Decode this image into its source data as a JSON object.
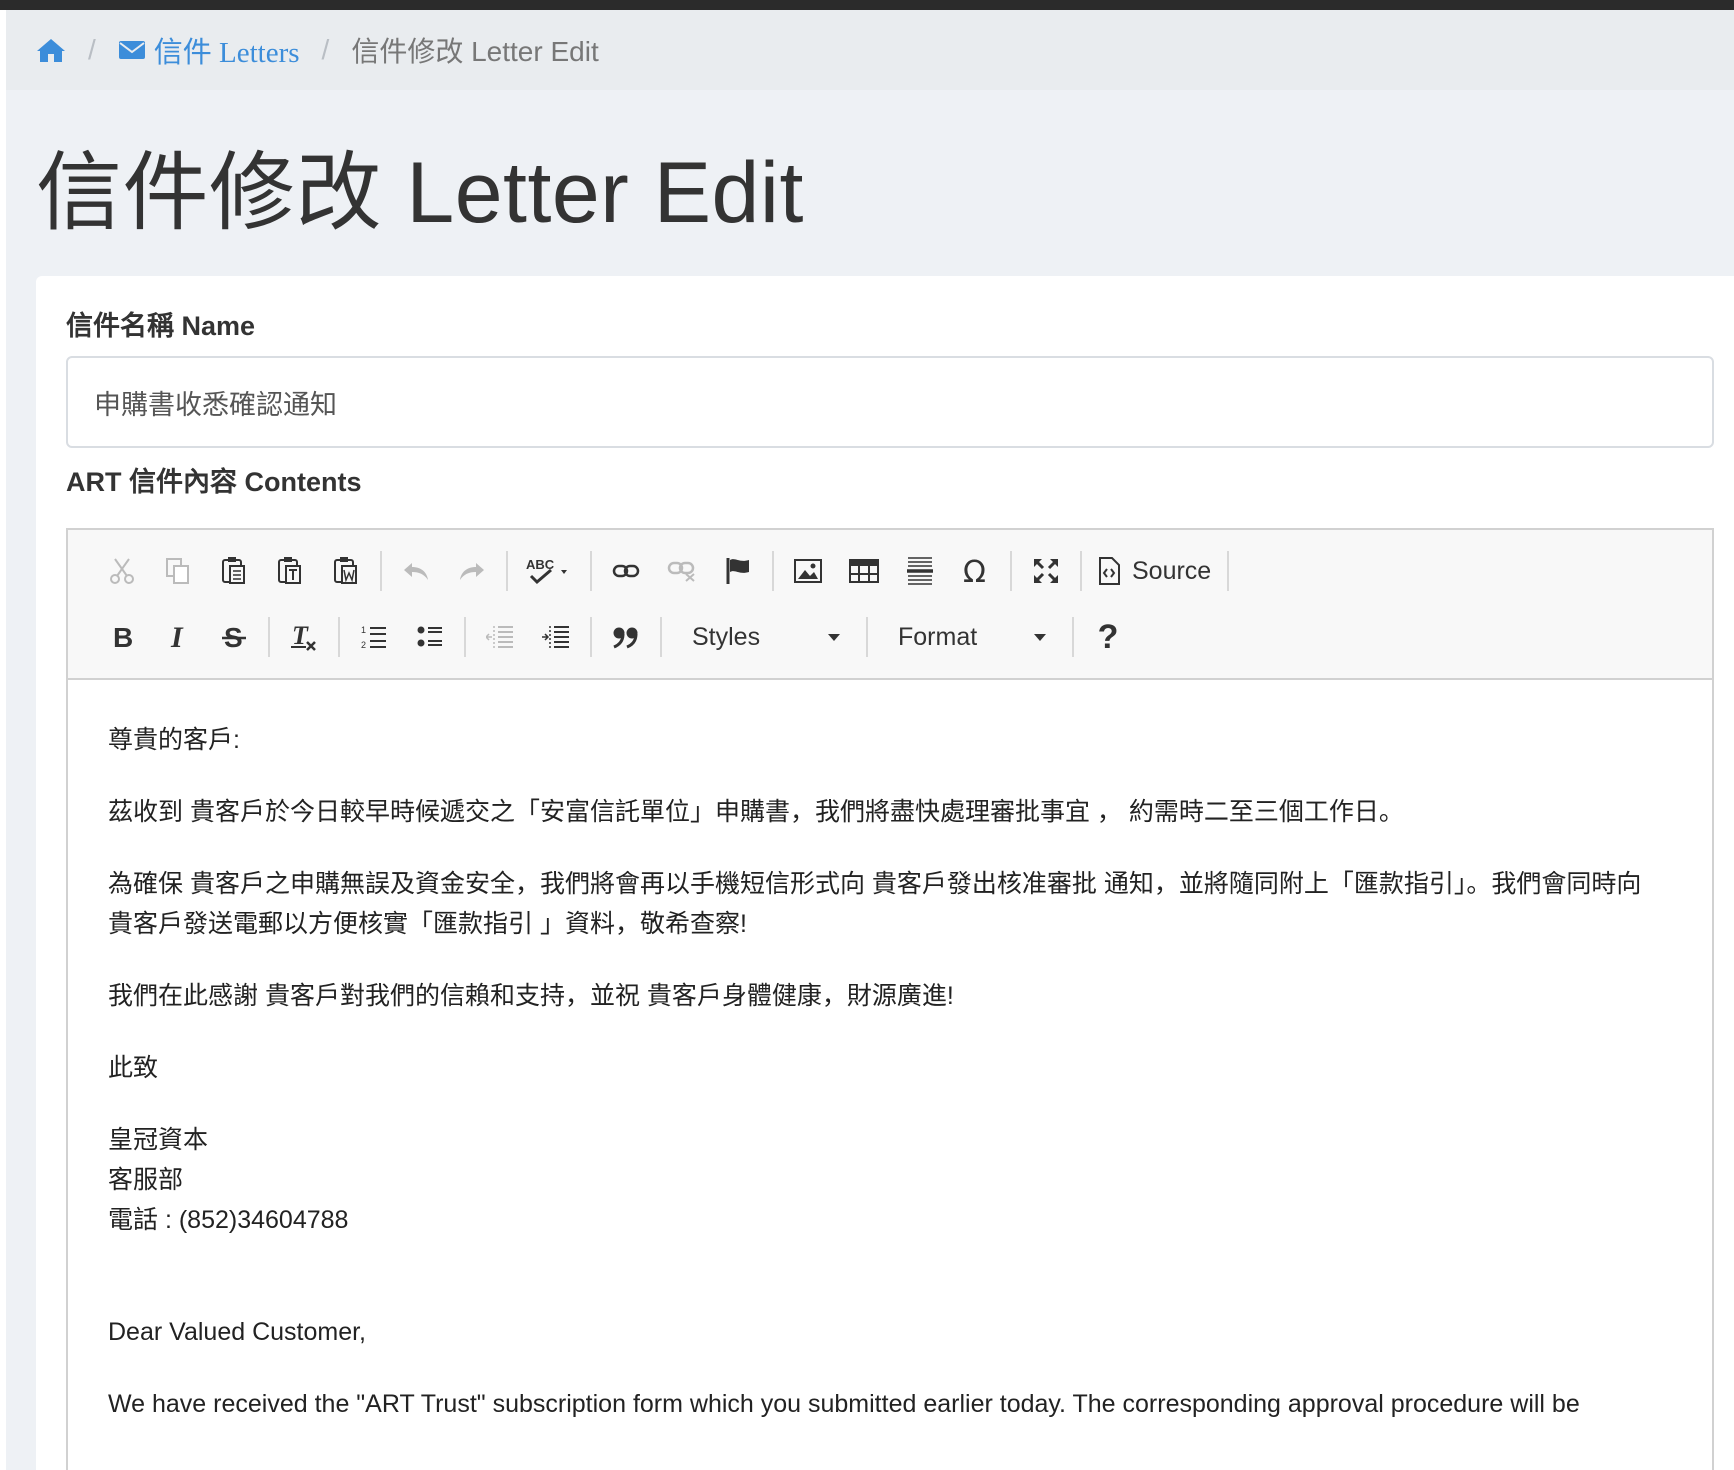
{
  "breadcrumb": {
    "letters_label": "信件 Letters",
    "current_label": "信件修改 Letter Edit"
  },
  "page": {
    "title": "信件修改 Letter Edit"
  },
  "form": {
    "name_label": "信件名稱 Name",
    "name_value": "申購書收悉確認通知",
    "contents_label": "ART 信件內容 Contents"
  },
  "toolbar": {
    "source_label": "Source",
    "styles_label": "Styles",
    "format_label": "Format",
    "help_label": "?"
  },
  "icons": [
    "home-icon",
    "envelope-icon",
    "cut-icon",
    "copy-icon",
    "paste-icon",
    "paste-text-icon",
    "paste-word-icon",
    "undo-icon",
    "redo-icon",
    "spellcheck-icon",
    "link-icon",
    "unlink-icon",
    "anchor-flag-icon",
    "image-icon",
    "table-icon",
    "horizontal-line-icon",
    "special-char-icon",
    "maximize-icon",
    "source-icon",
    "bold-icon",
    "italic-icon",
    "strike-icon",
    "remove-format-icon",
    "numbered-list-icon",
    "bulleted-list-icon",
    "outdent-icon",
    "indent-icon",
    "blockquote-icon"
  ],
  "colors": {
    "link": "#3c8dda",
    "breadcrumb_bg": "#e9ecef",
    "page_bg": "#eef1f5",
    "toolbar_bg": "#f8f8f8"
  },
  "letter": {
    "greeting_zh": "尊貴的客戶:",
    "para1_zh": "茲收到 貴客戶於今日較早時候遞交之「安富信託單位」申購書，我們將盡快處理審批事宜 ， 約需時二至三個工作日。",
    "para2_zh": "為確保 貴客戶之申購無誤及資金安全，我們將會再以手機短信形式向 貴客戶發出核准審批 通知，並將隨同附上「匯款指引」。我們會同時向 貴客戶發送電郵以方便核實「匯款指引 」資料，敬希查察!",
    "para3_zh": "我們在此感謝 貴客戶對我們的信賴和支持，並祝 貴客戶身體健康，財源廣進!",
    "closing_zh": "此致",
    "company_zh": "皇冠資本",
    "dept_zh": "客服部",
    "phone_zh": "電話 : (852)34604788",
    "greeting_en": "Dear Valued Customer,",
    "para1_en": "We have received the \"ART Trust\" subscription form which you submitted earlier today. The corresponding approval procedure will be"
  }
}
